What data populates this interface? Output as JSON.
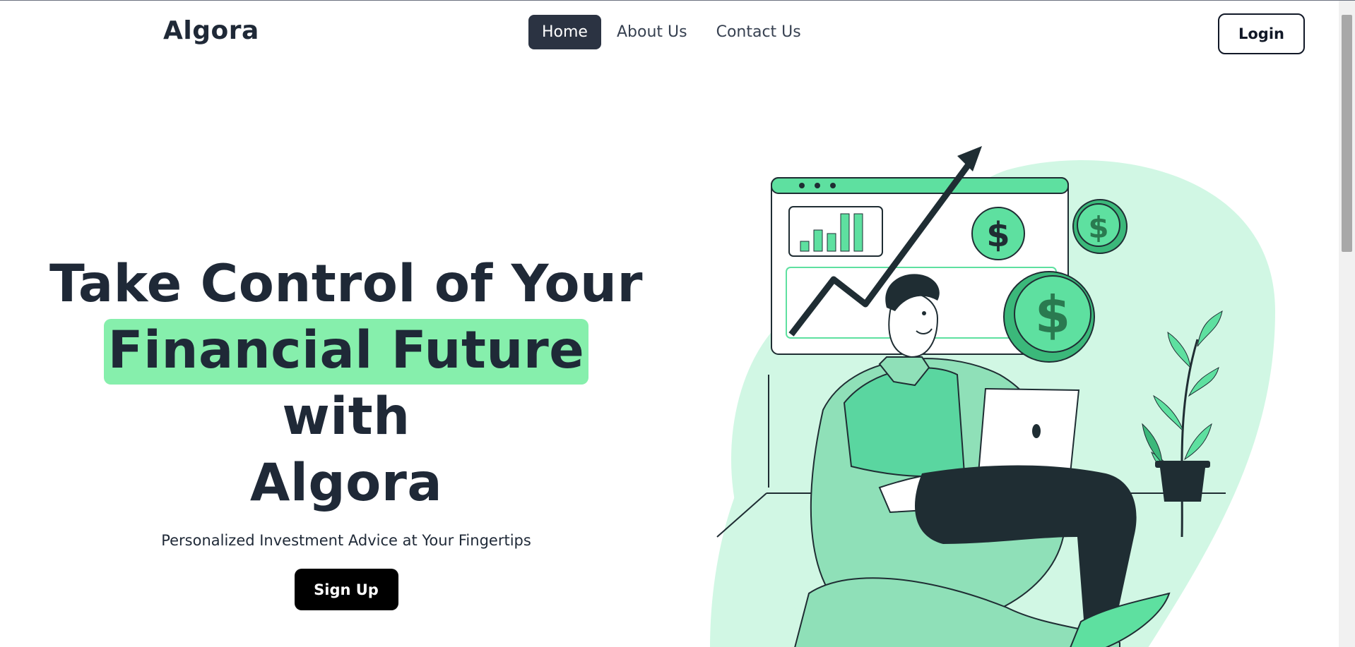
{
  "nav": {
    "brand": "Algora",
    "links": [
      {
        "label": "Home",
        "active": true
      },
      {
        "label": "About Us",
        "active": false
      },
      {
        "label": "Contact Us",
        "active": false
      }
    ],
    "login_label": "Login"
  },
  "hero": {
    "title_line1": "Take Control of Your",
    "title_highlight": "Financial Future",
    "title_line2_rest": " with",
    "title_line3": "Algora",
    "subtitle": "Personalized Investment Advice at Your Fingertips",
    "signup_label": "Sign Up"
  },
  "colors": {
    "accent": "#86efac",
    "illustration_green": "#5ee0a0",
    "illustration_light": "#d1f7e4",
    "dark": "#1f2d33"
  },
  "icons": [
    "dollar-coin-icon",
    "growth-arrow-icon",
    "bar-chart-icon",
    "plant-icon",
    "laptop-icon"
  ]
}
